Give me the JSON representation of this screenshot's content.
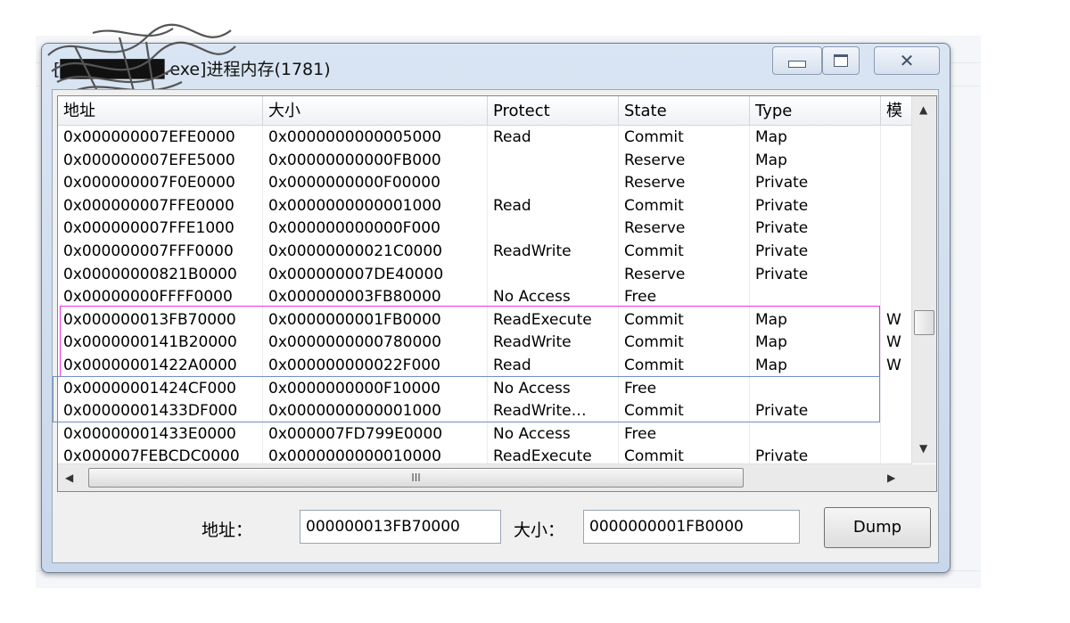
{
  "window": {
    "title": "[████████.exe]进程内存(1781)",
    "minimize_icon": "minimize-icon",
    "maximize_icon": "maximize-icon",
    "close_icon": "close-icon"
  },
  "table": {
    "columns": [
      "地址",
      "大小",
      "Protect",
      "State",
      "Type",
      "模"
    ],
    "rows": [
      [
        "0x000000007EFE0000",
        "0x0000000000005000",
        "Read",
        "Commit",
        "Map",
        ""
      ],
      [
        "0x000000007EFE5000",
        "0x00000000000FB000",
        "",
        "Reserve",
        "Map",
        ""
      ],
      [
        "0x000000007F0E0000",
        "0x0000000000F00000",
        "",
        "Reserve",
        "Private",
        ""
      ],
      [
        "0x000000007FFE0000",
        "0x0000000000001000",
        "Read",
        "Commit",
        "Private",
        ""
      ],
      [
        "0x000000007FFE1000",
        "0x000000000000F000",
        "",
        "Reserve",
        "Private",
        ""
      ],
      [
        "0x000000007FFF0000",
        "0x00000000021C0000",
        "ReadWrite",
        "Commit",
        "Private",
        ""
      ],
      [
        "0x00000000821B0000",
        "0x000000007DE40000",
        "",
        "Reserve",
        "Private",
        ""
      ],
      [
        "0x00000000FFFF0000",
        "0x000000003FB80000",
        "No Access",
        "Free",
        "",
        ""
      ],
      [
        "0x000000013FB70000",
        "0x0000000001FB0000",
        "ReadExecute",
        "Commit",
        "Map",
        "W"
      ],
      [
        "0x0000000141B20000",
        "0x0000000000780000",
        "ReadWrite",
        "Commit",
        "Map",
        "W"
      ],
      [
        "0x00000001422A0000",
        "0x000000000022F000",
        "Read",
        "Commit",
        "Map",
        "W"
      ],
      [
        "0x00000001424CF000",
        "0x0000000000F10000",
        "No Access",
        "Free",
        "",
        ""
      ],
      [
        "0x00000001433DF000",
        "0x0000000000001000",
        "ReadWrite…",
        "Commit",
        "Private",
        ""
      ],
      [
        "0x00000001433E0000",
        "0x000007FD799E0000",
        "No Access",
        "Free",
        "",
        ""
      ],
      [
        "0x000007FEBCDC0000",
        "0x0000000000010000",
        "ReadExecute",
        "Commit",
        "Private",
        ""
      ]
    ],
    "hscroll_grip": "III"
  },
  "footer": {
    "address_label": "地址：",
    "address_value": "000000013FB70000",
    "size_label": "大小：",
    "size_value": "0000000001FB0000",
    "dump_label": "Dump"
  },
  "colors": {
    "highlight_pink": "#e633e6",
    "highlight_blue": "#6f8fc6"
  }
}
